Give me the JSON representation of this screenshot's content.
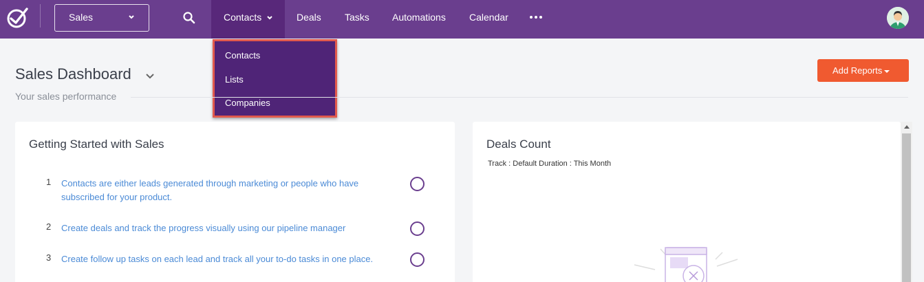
{
  "topbar": {
    "module_select_value": "Sales",
    "nav": {
      "contacts": "Contacts",
      "deals": "Deals",
      "tasks": "Tasks",
      "automations": "Automations",
      "calendar": "Calendar"
    },
    "icons": [
      "app-logo",
      "search-icon",
      "chevron-down-icon",
      "more-icon",
      "user-avatar"
    ]
  },
  "contacts_menu": {
    "items": [
      "Contacts",
      "Lists",
      "Companies"
    ],
    "highlight_color": "#e15a4d"
  },
  "dashboard": {
    "title": "Sales Dashboard",
    "subtitle": "Your sales performance",
    "add_reports_label": "Add Reports"
  },
  "getting_started": {
    "title": "Getting Started with Sales",
    "steps": [
      {
        "num": "1",
        "text": "Contacts are either leads generated through marketing or people who have subscribed for your product."
      },
      {
        "num": "2",
        "text": "Create deals and track the progress visually using our pipeline manager"
      },
      {
        "num": "3",
        "text": "Create follow up tasks on each lead and track all your to-do tasks in one place."
      }
    ]
  },
  "deals_count": {
    "title": "Deals Count",
    "filter_text": "Track : Default Duration : This Month"
  },
  "colors": {
    "topbar": "#6a3e8e",
    "nav_active": "#58287a",
    "menu_bg": "#4f2477",
    "accent_button": "#f05a30",
    "link": "#4a8ad6"
  }
}
